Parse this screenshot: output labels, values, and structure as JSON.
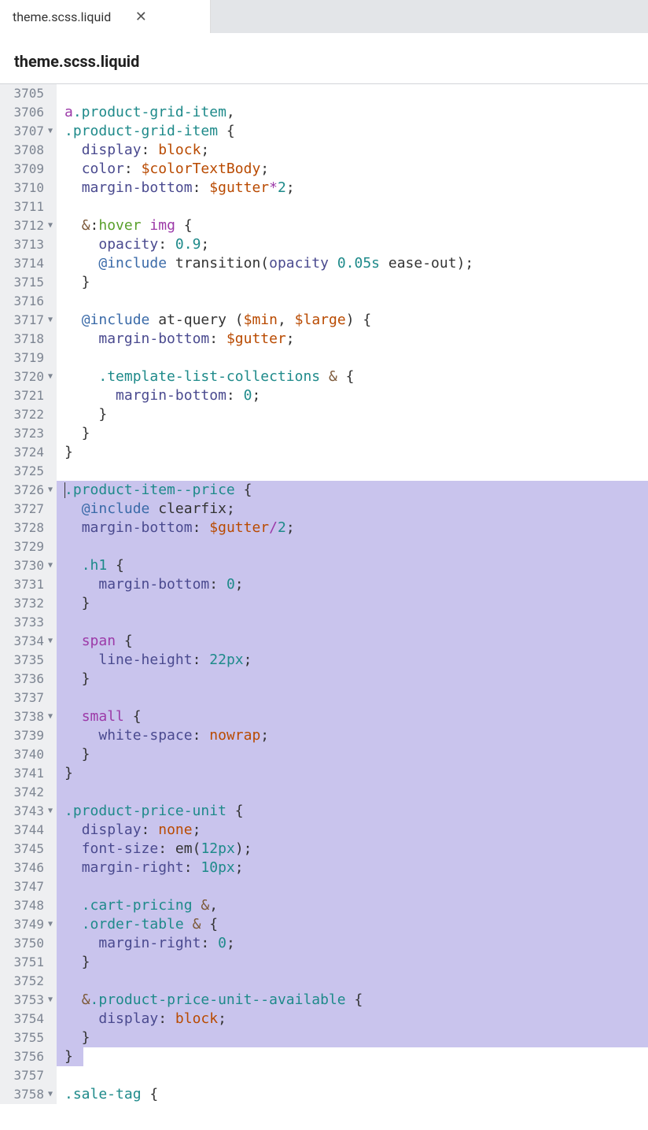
{
  "tab": {
    "label": "theme.scss.liquid"
  },
  "file_header": "theme.scss.liquid",
  "lines": [
    {
      "n": 3705,
      "fold": false,
      "hl": false,
      "tokens": []
    },
    {
      "n": 3706,
      "fold": false,
      "hl": false,
      "tokens": [
        {
          "t": "a",
          "c": "tok-tag"
        },
        {
          "t": ".product-grid-item",
          "c": "tok-class"
        },
        {
          "t": ",",
          "c": "tok-punct"
        }
      ]
    },
    {
      "n": 3707,
      "fold": true,
      "hl": false,
      "tokens": [
        {
          "t": ".product-grid-item",
          "c": "tok-class"
        },
        {
          "t": " {",
          "c": "tok-punct"
        }
      ]
    },
    {
      "n": 3708,
      "fold": false,
      "hl": false,
      "tokens": [
        {
          "t": "  ",
          "c": ""
        },
        {
          "t": "display",
          "c": "tok-prop"
        },
        {
          "t": ": ",
          "c": "tok-punct"
        },
        {
          "t": "block",
          "c": "tok-value-kw"
        },
        {
          "t": ";",
          "c": "tok-punct"
        }
      ]
    },
    {
      "n": 3709,
      "fold": false,
      "hl": false,
      "tokens": [
        {
          "t": "  ",
          "c": ""
        },
        {
          "t": "color",
          "c": "tok-prop"
        },
        {
          "t": ": ",
          "c": "tok-punct"
        },
        {
          "t": "$colorTextBody",
          "c": "tok-var"
        },
        {
          "t": ";",
          "c": "tok-punct"
        }
      ]
    },
    {
      "n": 3710,
      "fold": false,
      "hl": false,
      "tokens": [
        {
          "t": "  ",
          "c": ""
        },
        {
          "t": "margin-bottom",
          "c": "tok-prop"
        },
        {
          "t": ": ",
          "c": "tok-punct"
        },
        {
          "t": "$gutter",
          "c": "tok-var"
        },
        {
          "t": "*",
          "c": "tok-op"
        },
        {
          "t": "2",
          "c": "tok-num"
        },
        {
          "t": ";",
          "c": "tok-punct"
        }
      ]
    },
    {
      "n": 3711,
      "fold": false,
      "hl": false,
      "tokens": []
    },
    {
      "n": 3712,
      "fold": true,
      "hl": false,
      "tokens": [
        {
          "t": "  ",
          "c": ""
        },
        {
          "t": "&",
          "c": "tok-amp"
        },
        {
          "t": ":",
          "c": "tok-punct"
        },
        {
          "t": "hover",
          "c": "tok-pseudo"
        },
        {
          "t": " ",
          "c": ""
        },
        {
          "t": "img",
          "c": "tok-tag"
        },
        {
          "t": " {",
          "c": "tok-punct"
        }
      ]
    },
    {
      "n": 3713,
      "fold": false,
      "hl": false,
      "tokens": [
        {
          "t": "    ",
          "c": ""
        },
        {
          "t": "opacity",
          "c": "tok-prop"
        },
        {
          "t": ": ",
          "c": "tok-punct"
        },
        {
          "t": "0.9",
          "c": "tok-num"
        },
        {
          "t": ";",
          "c": "tok-punct"
        }
      ]
    },
    {
      "n": 3714,
      "fold": false,
      "hl": false,
      "tokens": [
        {
          "t": "    ",
          "c": ""
        },
        {
          "t": "@include",
          "c": "tok-atrule"
        },
        {
          "t": " ",
          "c": ""
        },
        {
          "t": "transition",
          "c": "tok-func"
        },
        {
          "t": "(",
          "c": "tok-punct"
        },
        {
          "t": "opacity",
          "c": "tok-prop"
        },
        {
          "t": " ",
          "c": ""
        },
        {
          "t": "0.05s",
          "c": "tok-num"
        },
        {
          "t": " ",
          "c": ""
        },
        {
          "t": "ease-out",
          "c": "tok-func"
        },
        {
          "t": ");",
          "c": "tok-punct"
        }
      ]
    },
    {
      "n": 3715,
      "fold": false,
      "hl": false,
      "tokens": [
        {
          "t": "  }",
          "c": "tok-punct"
        }
      ]
    },
    {
      "n": 3716,
      "fold": false,
      "hl": false,
      "tokens": []
    },
    {
      "n": 3717,
      "fold": true,
      "hl": false,
      "tokens": [
        {
          "t": "  ",
          "c": ""
        },
        {
          "t": "@include",
          "c": "tok-atrule"
        },
        {
          "t": " ",
          "c": ""
        },
        {
          "t": "at-query",
          "c": "tok-func"
        },
        {
          "t": " (",
          "c": "tok-punct"
        },
        {
          "t": "$min",
          "c": "tok-var"
        },
        {
          "t": ", ",
          "c": "tok-punct"
        },
        {
          "t": "$large",
          "c": "tok-var"
        },
        {
          "t": ") {",
          "c": "tok-punct"
        }
      ]
    },
    {
      "n": 3718,
      "fold": false,
      "hl": false,
      "tokens": [
        {
          "t": "    ",
          "c": ""
        },
        {
          "t": "margin-bottom",
          "c": "tok-prop"
        },
        {
          "t": ": ",
          "c": "tok-punct"
        },
        {
          "t": "$gutter",
          "c": "tok-var"
        },
        {
          "t": ";",
          "c": "tok-punct"
        }
      ]
    },
    {
      "n": 3719,
      "fold": false,
      "hl": false,
      "tokens": []
    },
    {
      "n": 3720,
      "fold": true,
      "hl": false,
      "tokens": [
        {
          "t": "    ",
          "c": ""
        },
        {
          "t": ".template-list-collections",
          "c": "tok-class"
        },
        {
          "t": " ",
          "c": ""
        },
        {
          "t": "&",
          "c": "tok-amp"
        },
        {
          "t": " {",
          "c": "tok-punct"
        }
      ]
    },
    {
      "n": 3721,
      "fold": false,
      "hl": false,
      "tokens": [
        {
          "t": "      ",
          "c": ""
        },
        {
          "t": "margin-bottom",
          "c": "tok-prop"
        },
        {
          "t": ": ",
          "c": "tok-punct"
        },
        {
          "t": "0",
          "c": "tok-num"
        },
        {
          "t": ";",
          "c": "tok-punct"
        }
      ]
    },
    {
      "n": 3722,
      "fold": false,
      "hl": false,
      "tokens": [
        {
          "t": "    }",
          "c": "tok-punct"
        }
      ]
    },
    {
      "n": 3723,
      "fold": false,
      "hl": false,
      "tokens": [
        {
          "t": "  }",
          "c": "tok-punct"
        }
      ]
    },
    {
      "n": 3724,
      "fold": false,
      "hl": false,
      "tokens": [
        {
          "t": "}",
          "c": "tok-punct"
        }
      ]
    },
    {
      "n": 3725,
      "fold": false,
      "hl": false,
      "tokens": []
    },
    {
      "n": 3726,
      "fold": true,
      "hl": true,
      "cursor": true,
      "tokens": [
        {
          "t": ".product-item--price",
          "c": "tok-class"
        },
        {
          "t": " {",
          "c": "tok-punct"
        }
      ]
    },
    {
      "n": 3727,
      "fold": false,
      "hl": true,
      "tokens": [
        {
          "t": "  ",
          "c": ""
        },
        {
          "t": "@include",
          "c": "tok-atrule"
        },
        {
          "t": " ",
          "c": ""
        },
        {
          "t": "clearfix",
          "c": "tok-func"
        },
        {
          "t": ";",
          "c": "tok-punct"
        }
      ]
    },
    {
      "n": 3728,
      "fold": false,
      "hl": true,
      "tokens": [
        {
          "t": "  ",
          "c": ""
        },
        {
          "t": "margin-bottom",
          "c": "tok-prop"
        },
        {
          "t": ": ",
          "c": "tok-punct"
        },
        {
          "t": "$gutter",
          "c": "tok-var"
        },
        {
          "t": "/",
          "c": "tok-op"
        },
        {
          "t": "2",
          "c": "tok-num"
        },
        {
          "t": ";",
          "c": "tok-punct"
        }
      ]
    },
    {
      "n": 3729,
      "fold": false,
      "hl": true,
      "tokens": []
    },
    {
      "n": 3730,
      "fold": true,
      "hl": true,
      "tokens": [
        {
          "t": "  ",
          "c": ""
        },
        {
          "t": ".h1",
          "c": "tok-class"
        },
        {
          "t": " {",
          "c": "tok-punct"
        }
      ]
    },
    {
      "n": 3731,
      "fold": false,
      "hl": true,
      "tokens": [
        {
          "t": "    ",
          "c": ""
        },
        {
          "t": "margin-bottom",
          "c": "tok-prop"
        },
        {
          "t": ": ",
          "c": "tok-punct"
        },
        {
          "t": "0",
          "c": "tok-num"
        },
        {
          "t": ";",
          "c": "tok-punct"
        }
      ]
    },
    {
      "n": 3732,
      "fold": false,
      "hl": true,
      "tokens": [
        {
          "t": "  }",
          "c": "tok-punct"
        }
      ]
    },
    {
      "n": 3733,
      "fold": false,
      "hl": true,
      "tokens": []
    },
    {
      "n": 3734,
      "fold": true,
      "hl": true,
      "tokens": [
        {
          "t": "  ",
          "c": ""
        },
        {
          "t": "span",
          "c": "tok-tag"
        },
        {
          "t": " {",
          "c": "tok-punct"
        }
      ]
    },
    {
      "n": 3735,
      "fold": false,
      "hl": true,
      "tokens": [
        {
          "t": "    ",
          "c": ""
        },
        {
          "t": "line-height",
          "c": "tok-prop"
        },
        {
          "t": ": ",
          "c": "tok-punct"
        },
        {
          "t": "22px",
          "c": "tok-num"
        },
        {
          "t": ";",
          "c": "tok-punct"
        }
      ]
    },
    {
      "n": 3736,
      "fold": false,
      "hl": true,
      "tokens": [
        {
          "t": "  }",
          "c": "tok-punct"
        }
      ]
    },
    {
      "n": 3737,
      "fold": false,
      "hl": true,
      "tokens": []
    },
    {
      "n": 3738,
      "fold": true,
      "hl": true,
      "tokens": [
        {
          "t": "  ",
          "c": ""
        },
        {
          "t": "small",
          "c": "tok-tag"
        },
        {
          "t": " {",
          "c": "tok-punct"
        }
      ]
    },
    {
      "n": 3739,
      "fold": false,
      "hl": true,
      "tokens": [
        {
          "t": "    ",
          "c": ""
        },
        {
          "t": "white-space",
          "c": "tok-prop"
        },
        {
          "t": ": ",
          "c": "tok-punct"
        },
        {
          "t": "nowrap",
          "c": "tok-value-kw"
        },
        {
          "t": ";",
          "c": "tok-punct"
        }
      ]
    },
    {
      "n": 3740,
      "fold": false,
      "hl": true,
      "tokens": [
        {
          "t": "  }",
          "c": "tok-punct"
        }
      ]
    },
    {
      "n": 3741,
      "fold": false,
      "hl": true,
      "tokens": [
        {
          "t": "}",
          "c": "tok-punct"
        }
      ]
    },
    {
      "n": 3742,
      "fold": false,
      "hl": true,
      "tokens": []
    },
    {
      "n": 3743,
      "fold": true,
      "hl": true,
      "tokens": [
        {
          "t": ".product-price-unit",
          "c": "tok-class"
        },
        {
          "t": " {",
          "c": "tok-punct"
        }
      ]
    },
    {
      "n": 3744,
      "fold": false,
      "hl": true,
      "tokens": [
        {
          "t": "  ",
          "c": ""
        },
        {
          "t": "display",
          "c": "tok-prop"
        },
        {
          "t": ": ",
          "c": "tok-punct"
        },
        {
          "t": "none",
          "c": "tok-value-kw"
        },
        {
          "t": ";",
          "c": "tok-punct"
        }
      ]
    },
    {
      "n": 3745,
      "fold": false,
      "hl": true,
      "tokens": [
        {
          "t": "  ",
          "c": ""
        },
        {
          "t": "font-size",
          "c": "tok-prop"
        },
        {
          "t": ": ",
          "c": "tok-punct"
        },
        {
          "t": "em",
          "c": "tok-func"
        },
        {
          "t": "(",
          "c": "tok-punct"
        },
        {
          "t": "12px",
          "c": "tok-num"
        },
        {
          "t": ");",
          "c": "tok-punct"
        }
      ]
    },
    {
      "n": 3746,
      "fold": false,
      "hl": true,
      "tokens": [
        {
          "t": "  ",
          "c": ""
        },
        {
          "t": "margin-right",
          "c": "tok-prop"
        },
        {
          "t": ": ",
          "c": "tok-punct"
        },
        {
          "t": "10px",
          "c": "tok-num"
        },
        {
          "t": ";",
          "c": "tok-punct"
        }
      ]
    },
    {
      "n": 3747,
      "fold": false,
      "hl": true,
      "tokens": []
    },
    {
      "n": 3748,
      "fold": false,
      "hl": true,
      "tokens": [
        {
          "t": "  ",
          "c": ""
        },
        {
          "t": ".cart-pricing",
          "c": "tok-class"
        },
        {
          "t": " ",
          "c": ""
        },
        {
          "t": "&",
          "c": "tok-amp"
        },
        {
          "t": ",",
          "c": "tok-punct"
        }
      ]
    },
    {
      "n": 3749,
      "fold": true,
      "hl": true,
      "tokens": [
        {
          "t": "  ",
          "c": ""
        },
        {
          "t": ".order-table",
          "c": "tok-class"
        },
        {
          "t": " ",
          "c": ""
        },
        {
          "t": "&",
          "c": "tok-amp"
        },
        {
          "t": " {",
          "c": "tok-punct"
        }
      ]
    },
    {
      "n": 3750,
      "fold": false,
      "hl": true,
      "tokens": [
        {
          "t": "    ",
          "c": ""
        },
        {
          "t": "margin-right",
          "c": "tok-prop"
        },
        {
          "t": ": ",
          "c": "tok-punct"
        },
        {
          "t": "0",
          "c": "tok-num"
        },
        {
          "t": ";",
          "c": "tok-punct"
        }
      ]
    },
    {
      "n": 3751,
      "fold": false,
      "hl": true,
      "tokens": [
        {
          "t": "  }",
          "c": "tok-punct"
        }
      ]
    },
    {
      "n": 3752,
      "fold": false,
      "hl": true,
      "tokens": []
    },
    {
      "n": 3753,
      "fold": true,
      "hl": true,
      "tokens": [
        {
          "t": "  ",
          "c": ""
        },
        {
          "t": "&",
          "c": "tok-amp"
        },
        {
          "t": ".product-price-unit--available",
          "c": "tok-class"
        },
        {
          "t": " {",
          "c": "tok-punct"
        }
      ]
    },
    {
      "n": 3754,
      "fold": false,
      "hl": true,
      "tokens": [
        {
          "t": "    ",
          "c": ""
        },
        {
          "t": "display",
          "c": "tok-prop"
        },
        {
          "t": ": ",
          "c": "tok-punct"
        },
        {
          "t": "block",
          "c": "tok-value-kw"
        },
        {
          "t": ";",
          "c": "tok-punct"
        }
      ]
    },
    {
      "n": 3755,
      "fold": false,
      "hl": true,
      "tokens": [
        {
          "t": "  }",
          "c": "tok-punct"
        }
      ]
    },
    {
      "n": 3756,
      "fold": false,
      "hl": "partial",
      "hl_width": 24,
      "tokens": [
        {
          "t": "}",
          "c": "tok-punct"
        }
      ]
    },
    {
      "n": 3757,
      "fold": false,
      "hl": false,
      "tokens": []
    },
    {
      "n": 3758,
      "fold": true,
      "hl": false,
      "tokens": [
        {
          "t": ".sale-tag",
          "c": "tok-class"
        },
        {
          "t": " {",
          "c": "tok-punct"
        }
      ]
    }
  ]
}
